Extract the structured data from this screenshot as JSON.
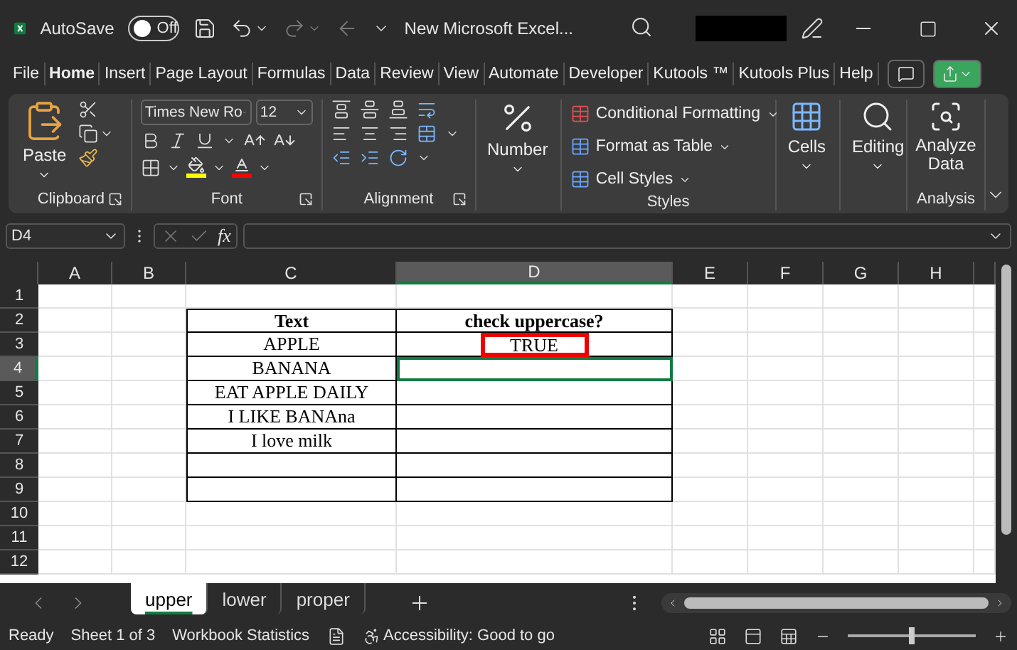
{
  "title_bar": {
    "autosave_label": "AutoSave",
    "autosave": {
      "on": false,
      "text": "Off"
    },
    "title": "New Microsoft Excel..."
  },
  "menu": [
    {
      "label": "File",
      "selected": false
    },
    {
      "label": "Home",
      "selected": true
    },
    {
      "label": "Insert",
      "selected": false
    },
    {
      "label": "Page Layout",
      "selected": false
    },
    {
      "label": "Formulas",
      "selected": false
    },
    {
      "label": "Data",
      "selected": false
    },
    {
      "label": "Review",
      "selected": false
    },
    {
      "label": "View",
      "selected": false
    },
    {
      "label": "Automate",
      "selected": false
    },
    {
      "label": "Developer",
      "selected": false
    },
    {
      "label": "Kutools ™",
      "selected": false
    },
    {
      "label": "Kutools Plus",
      "selected": false
    },
    {
      "label": "Help",
      "selected": false
    }
  ],
  "ribbon": {
    "clipboard": {
      "paste": "Paste",
      "label": "Clipboard"
    },
    "font": {
      "name": "Times New Ro",
      "size": "12",
      "label": "Font"
    },
    "alignment": {
      "label": "Alignment"
    },
    "number": {
      "label": "Number"
    },
    "styles": {
      "items": [
        "Conditional Formatting",
        "Format as Table",
        "Cell Styles"
      ],
      "label": "Styles"
    },
    "cells": {
      "label": "Cells"
    },
    "editing": {
      "label": "Editing"
    },
    "analysis": {
      "button": "Analyze Data",
      "label": "Analysis"
    }
  },
  "formula_bar": {
    "name_box": "D4",
    "fx": "fx"
  },
  "columns": [
    {
      "label": "A",
      "selected": false
    },
    {
      "label": "B",
      "selected": false
    },
    {
      "label": "C",
      "selected": false
    },
    {
      "label": "D",
      "selected": true
    },
    {
      "label": "E",
      "selected": false
    },
    {
      "label": "F",
      "selected": false
    },
    {
      "label": "G",
      "selected": false
    },
    {
      "label": "H",
      "selected": false
    }
  ],
  "rows": [
    {
      "label": "1",
      "selected": false,
      "boxed": false,
      "cells": {}
    },
    {
      "label": "2",
      "selected": false,
      "boxed": true,
      "cells": {
        "C": {
          "text": "Text",
          "bold": true
        },
        "D": {
          "text": "check uppercase?",
          "bold": true
        }
      }
    },
    {
      "label": "3",
      "selected": false,
      "boxed": true,
      "cells": {
        "C": {
          "text": "APPLE",
          "bold": false
        },
        "D": {
          "text": "TRUE",
          "bold": false,
          "marked": true
        }
      }
    },
    {
      "label": "4",
      "selected": true,
      "boxed": true,
      "cells": {
        "C": {
          "text": "BANANA",
          "bold": false
        }
      }
    },
    {
      "label": "5",
      "selected": false,
      "boxed": true,
      "cells": {
        "C": {
          "text": "EAT APPLE DAILY",
          "bold": false
        }
      }
    },
    {
      "label": "6",
      "selected": false,
      "boxed": true,
      "cells": {
        "C": {
          "text": "I LIKE BANAna",
          "bold": false
        }
      }
    },
    {
      "label": "7",
      "selected": false,
      "boxed": true,
      "cells": {
        "C": {
          "text": "I love milk",
          "bold": false
        }
      }
    },
    {
      "label": "8",
      "selected": false,
      "boxed": true,
      "cells": {}
    },
    {
      "label": "9",
      "selected": false,
      "boxed": true,
      "cells": {}
    },
    {
      "label": "10",
      "selected": false,
      "boxed": false,
      "cells": {}
    },
    {
      "label": "11",
      "selected": false,
      "boxed": false,
      "cells": {}
    },
    {
      "label": "12",
      "selected": false,
      "boxed": false,
      "cells": {}
    }
  ],
  "sheet_tabs": [
    {
      "label": "upper",
      "selected": true
    },
    {
      "label": "lower",
      "selected": false
    },
    {
      "label": "proper",
      "selected": false
    }
  ],
  "status_bar": {
    "ready": "Ready",
    "sheet": "Sheet 1 of 3",
    "statistics": "Workbook Statistics",
    "accessibility": "Accessibility: Good to go",
    "zoom": {
      "level": 0.5
    }
  }
}
